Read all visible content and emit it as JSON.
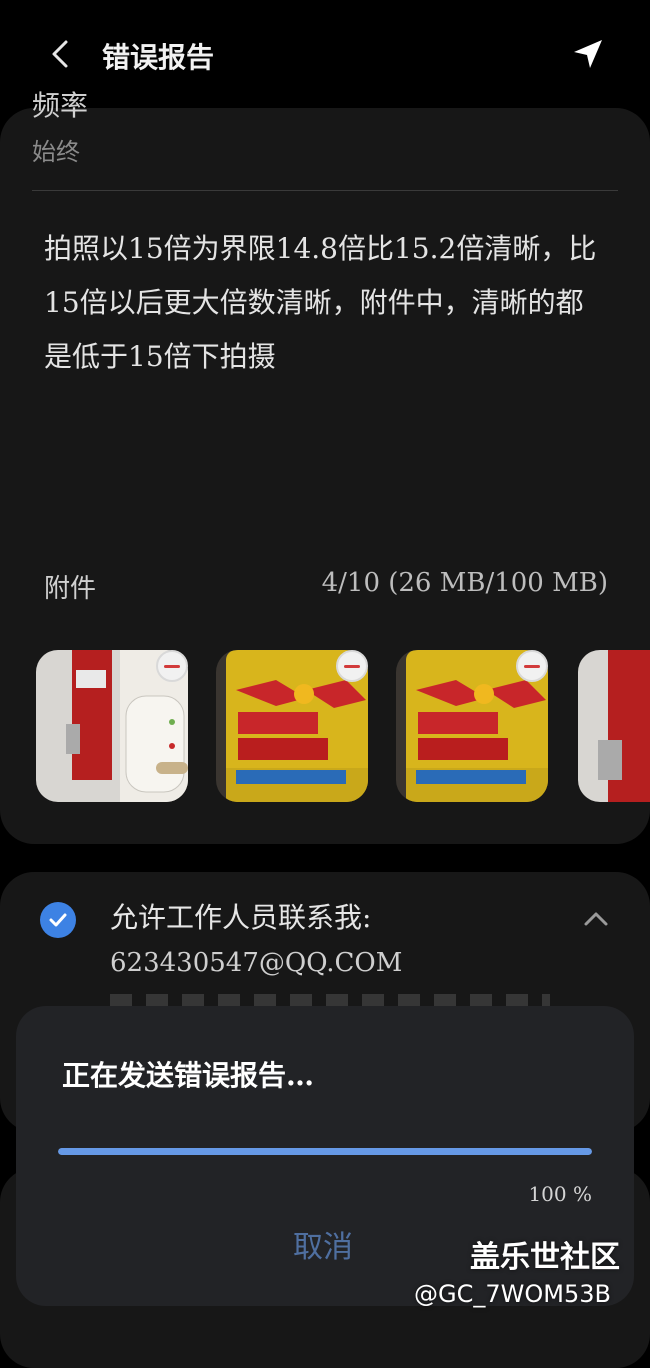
{
  "header": {
    "title": "错误报告",
    "back_icon": "chevron-left-icon",
    "send_icon": "send-icon"
  },
  "report": {
    "partial_label": "频率",
    "frequency_value": "始终",
    "description": "拍照以15倍为界限14.8倍比15.2倍清晰，比15倍以后更大倍数清晰，附件中，清晰的都是低于15倍下拍摄"
  },
  "attachments": {
    "label": "附件",
    "count": "4/10 (26 MB/100 MB)",
    "items": [
      {
        "name": "attachment-1",
        "desc": "red can and white device"
      },
      {
        "name": "attachment-2",
        "desc": "Red Bull can"
      },
      {
        "name": "attachment-3",
        "desc": "Red Bull can"
      },
      {
        "name": "attachment-4",
        "desc": "partial image"
      }
    ]
  },
  "contact": {
    "label": "允许工作人员联系我:",
    "email": "623430547@QQ.COM",
    "checked": true
  },
  "dialog": {
    "title": "正在发送错误报告…",
    "progress": 1.0,
    "progress_text": "100 %",
    "cancel_label": "取消"
  },
  "watermark": {
    "site": "盖乐世社区",
    "user": "@GC_7WOM53B"
  },
  "colors": {
    "accent": "#3d82e4",
    "progress": "#6699e6",
    "card": "#171717",
    "dialog": "#222326"
  }
}
